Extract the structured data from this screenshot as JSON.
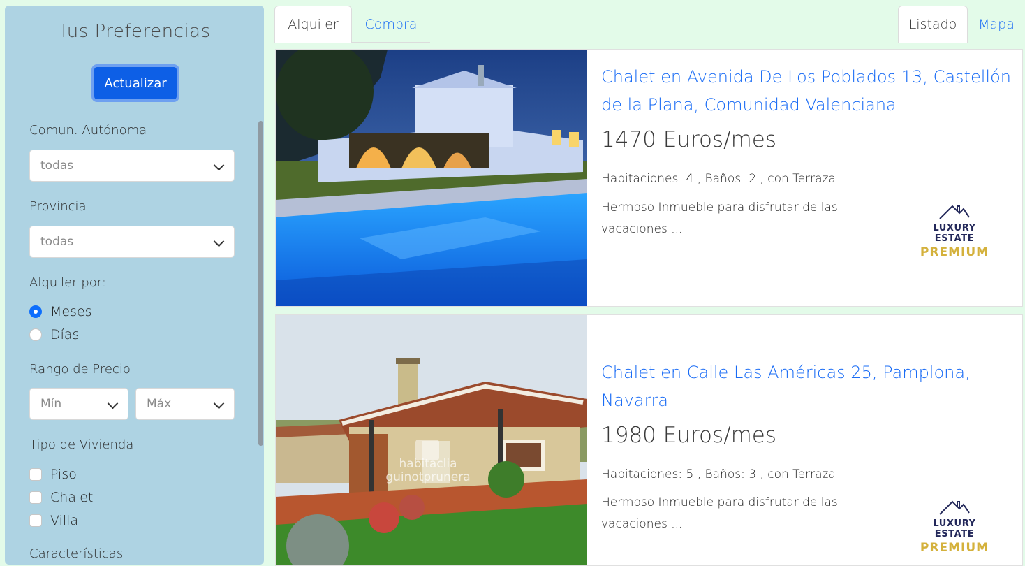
{
  "sidebar": {
    "title": "Tus Preferencias",
    "update_button": "Actualizar",
    "region_label": "Comun. Autónoma",
    "region_value": "todas",
    "province_label": "Provincia",
    "province_value": "todas",
    "rent_by_label": "Alquiler por:",
    "rent_options": [
      {
        "label": "Meses",
        "selected": true
      },
      {
        "label": "Días",
        "selected": false
      }
    ],
    "price_label": "Rango de Precio",
    "price_min": "Mín",
    "price_max": "Máx",
    "type_label": "Tipo de Vivienda",
    "types": [
      {
        "label": "Piso",
        "checked": false
      },
      {
        "label": "Chalet",
        "checked": false
      },
      {
        "label": "Villa",
        "checked": false
      }
    ],
    "features_label": "Características"
  },
  "tabs": {
    "left": [
      "Alquiler",
      "Compra"
    ],
    "right": [
      "Listado",
      "Mapa"
    ],
    "active_left": "Alquiler",
    "active_right": "Listado"
  },
  "listings": [
    {
      "title": "Chalet en Avenida De Los Poblados 13, Castellón de la Plana, Comunidad Valenciana",
      "price": "1470 Euros/mes",
      "features": "Habitaciones: 4 , Baños: 2 , con Terraza",
      "description": "Hermoso Inmueble para disfrutar de las vacaciones ...",
      "logo_line1": "LUXURY ESTATE",
      "logo_line2": "PREMIUM"
    },
    {
      "title": "Chalet en Calle Las Américas 25, Pamplona, Navarra",
      "price": "1980 Euros/mes",
      "features": "Habitaciones: 5 , Baños: 3 , con Terraza",
      "description": "Hermoso Inmueble para disfrutar de las vacaciones ...",
      "logo_line1": "LUXURY ESTATE",
      "logo_line2": "PREMIUM",
      "watermark_line1": "habitaclia",
      "watermark_line2": "guinotprunera"
    }
  ],
  "colors": {
    "page_bg": "#e3fbe9",
    "sidebar_bg": "#aed3e3",
    "accent": "#0d5fe6",
    "link": "#1a6cf5",
    "logo_navy": "#23285a",
    "logo_gold": "#d4b13c"
  }
}
